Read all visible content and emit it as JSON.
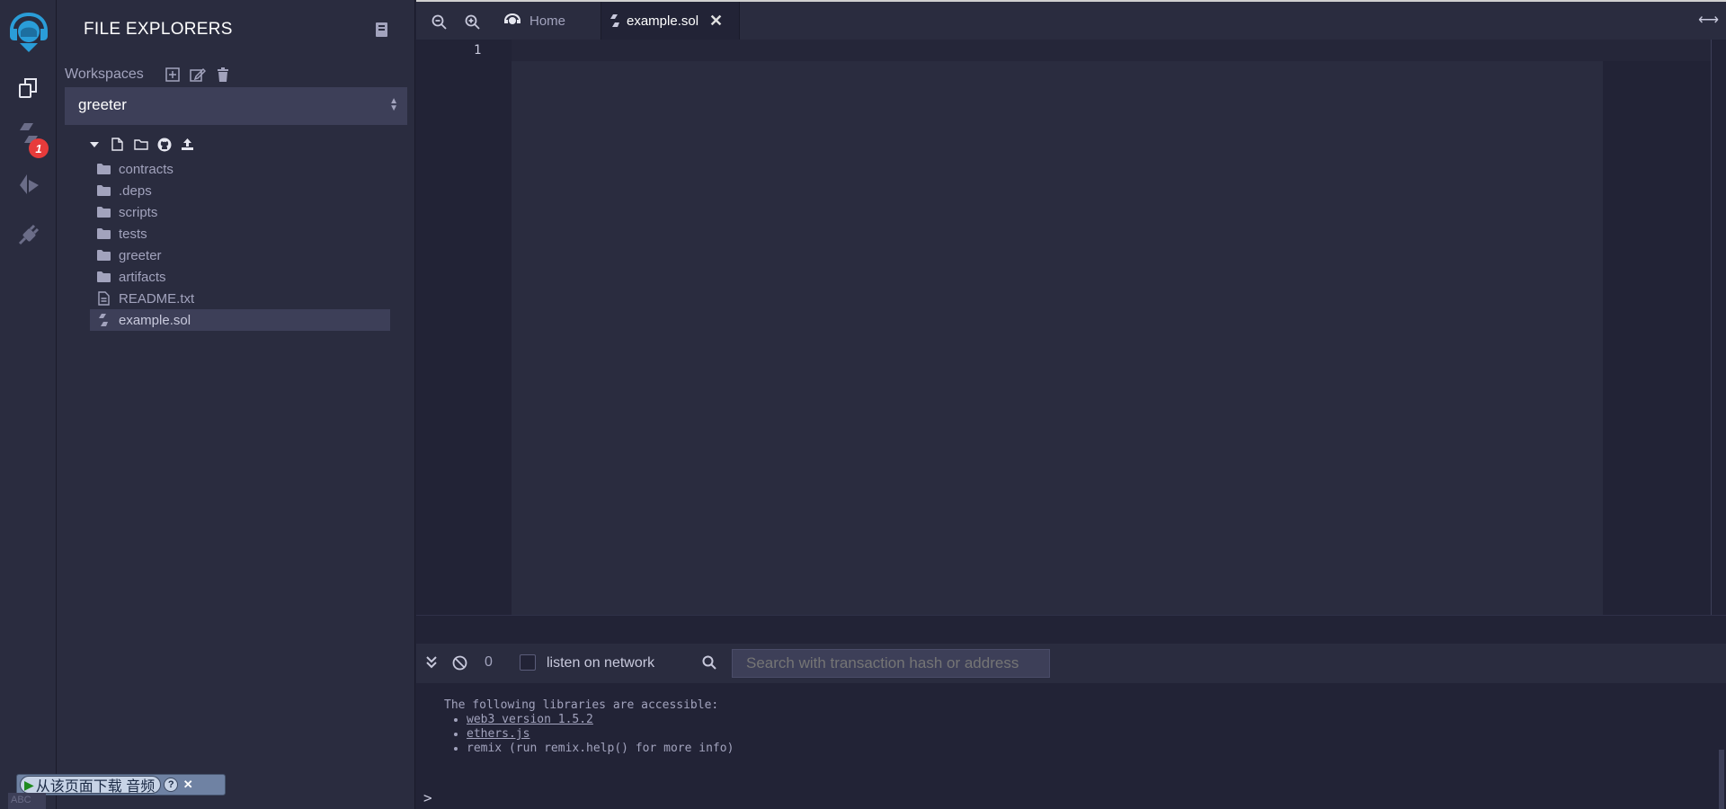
{
  "sidepanel": {
    "title": "FILE EXPLORERS",
    "workspaces_label": "Workspaces",
    "selected_workspace": "greeter",
    "tree": [
      {
        "name": "contracts",
        "type": "folder"
      },
      {
        "name": ".deps",
        "type": "folder"
      },
      {
        "name": "scripts",
        "type": "folder"
      },
      {
        "name": "tests",
        "type": "folder"
      },
      {
        "name": "greeter",
        "type": "folder"
      },
      {
        "name": "artifacts",
        "type": "folder"
      },
      {
        "name": "README.txt",
        "type": "file"
      },
      {
        "name": "example.sol",
        "type": "solidity",
        "active": true
      }
    ]
  },
  "iconbar": {
    "badge_count": "1",
    "items": [
      "file-explorers-icon",
      "solidity-compiler-icon",
      "deploy-run-icon",
      "plugin-manager-icon"
    ]
  },
  "tabs": {
    "home_label": "Home",
    "file_label": "example.sol"
  },
  "editor": {
    "line_numbers": [
      "1"
    ]
  },
  "terminal": {
    "count": "0",
    "listen_label": "listen on network",
    "search_placeholder": "Search with transaction hash or address",
    "intro": "The following libraries are accessible:",
    "libraries": [
      {
        "text": "web3 version 1.5.2",
        "link": true
      },
      {
        "text": "ethers.js",
        "link": true
      },
      {
        "text": "remix (run remix.help() for more info)",
        "link": false
      }
    ],
    "prompt": ">"
  },
  "overlay": {
    "download_label": "从该页面下载 音频",
    "help": "?",
    "close": "✕",
    "sub_label": "ABC"
  },
  "colors": {
    "panel_bg": "#2a2c3f",
    "editor_bg": "#222336",
    "accent_blue": "#2a9dd8",
    "badge_red": "#e73b3b"
  }
}
